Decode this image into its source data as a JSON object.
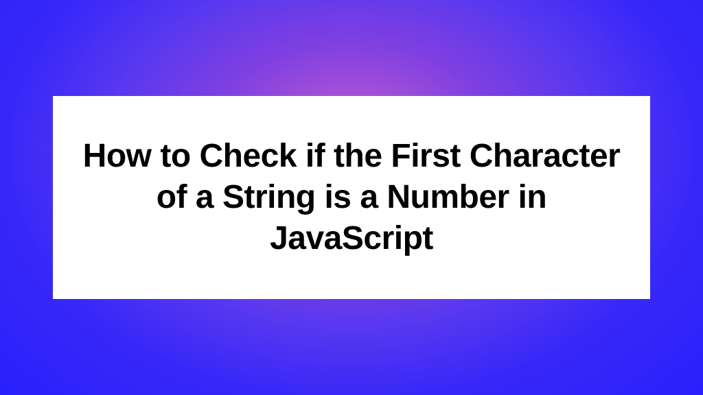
{
  "card": {
    "title": "How to Check if the First Character of a String is a Number in JavaScript"
  }
}
